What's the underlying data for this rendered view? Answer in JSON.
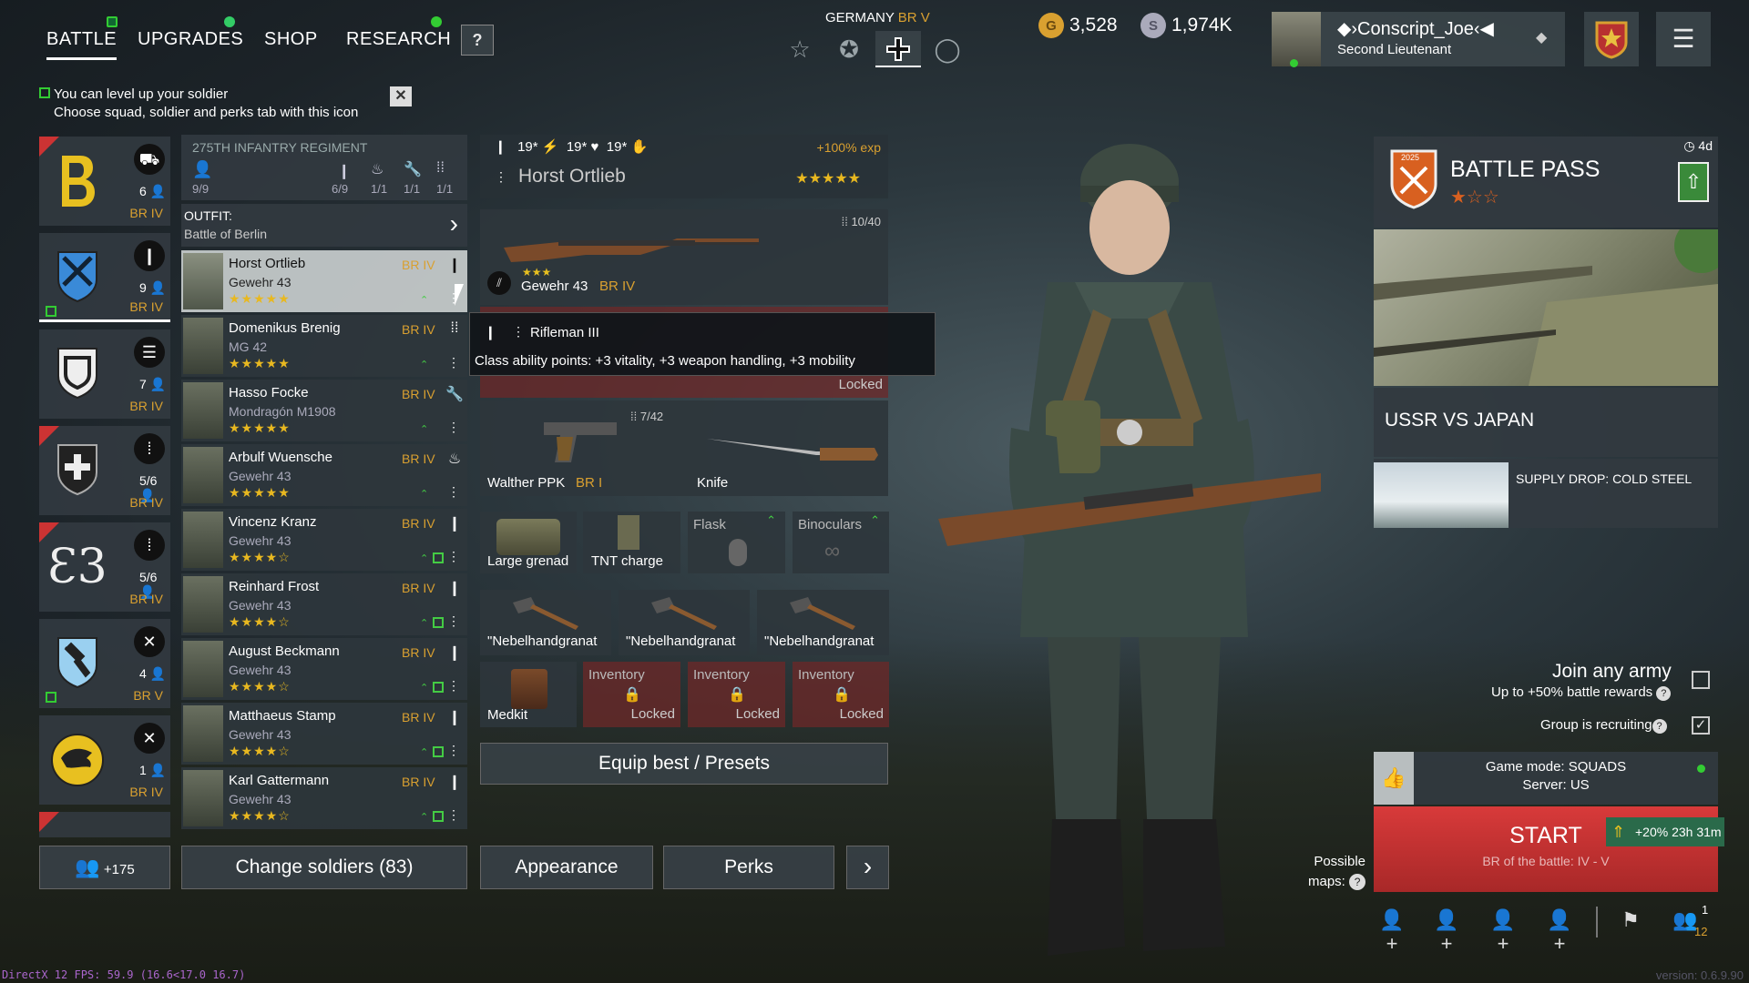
{
  "nav": {
    "tabs": [
      "BATTLE",
      "UPGRADES",
      "SHOP",
      "RESEARCH"
    ],
    "help": "?"
  },
  "army": {
    "nation": "GERMANY",
    "br": "BR V"
  },
  "currency": {
    "gold": "3,528",
    "silver": "1,974K"
  },
  "profile": {
    "name": "Conscript_Joe",
    "rank": "Second Lieutenant"
  },
  "hint": {
    "line1": "You can level up your soldier",
    "line2": "Choose squad, soldier and perks tab with this icon"
  },
  "squads": [
    {
      "count": "6",
      "br": "BR IV"
    },
    {
      "count": "9",
      "br": "BR IV"
    },
    {
      "count": "7",
      "br": "BR IV"
    },
    {
      "count": "5/6",
      "br": "BR IV"
    },
    {
      "count": "5/6",
      "br": "BR IV"
    },
    {
      "count": "4",
      "br": "BR V"
    },
    {
      "count": "1",
      "br": "BR IV"
    }
  ],
  "regiment": {
    "name": "275TH INFANTRY REGIMENT",
    "members": "9/9",
    "slots": [
      "6/9",
      "1/1",
      "1/1",
      "1/1"
    ]
  },
  "outfit": {
    "label": "OUTFIT:",
    "value": "Battle of Berlin"
  },
  "soldiers": [
    {
      "name": "Horst Ortlieb",
      "weapon": "Gewehr 43",
      "br": "BR IV",
      "stars": "★★★★★"
    },
    {
      "name": "Domenikus Brenig",
      "weapon": "MG 42",
      "br": "BR IV",
      "stars": "★★★★★"
    },
    {
      "name": "Hasso Focke",
      "weapon": "Mondragón M1908",
      "br": "BR IV",
      "stars": "★★★★★"
    },
    {
      "name": "Arbulf Wuensche",
      "weapon": "Gewehr 43",
      "br": "BR IV",
      "stars": "★★★★★"
    },
    {
      "name": "Vincenz Kranz",
      "weapon": "Gewehr 43",
      "br": "BR IV",
      "stars": "★★★★☆"
    },
    {
      "name": "Reinhard Frost",
      "weapon": "Gewehr 43",
      "br": "BR IV",
      "stars": "★★★★☆"
    },
    {
      "name": "August Beckmann",
      "weapon": "Gewehr 43",
      "br": "BR IV",
      "stars": "★★★★☆"
    },
    {
      "name": "Matthaeus Stamp",
      "weapon": "Gewehr 43",
      "br": "BR IV",
      "stars": "★★★★☆"
    },
    {
      "name": "Karl Gattermann",
      "weapon": "Gewehr 43",
      "br": "BR IV",
      "stars": "★★★★☆"
    }
  ],
  "selected": {
    "stats": [
      "19*",
      "19*",
      "19*"
    ],
    "exp": "+100% exp",
    "name": "Horst Ortlieb",
    "stars": "★★★★★"
  },
  "equipment": {
    "primary": {
      "name": "Gewehr 43",
      "br": "BR IV",
      "ammo": "10/40",
      "stars": "★★★"
    },
    "secondary_locked": "Locked",
    "pistol": {
      "name": "Walther PPK",
      "br": "BR I",
      "ammo": "7/42"
    },
    "melee": {
      "name": "Knife"
    },
    "slots": [
      "Large grenad",
      "TNT charge",
      "Flask",
      "Binoculars"
    ],
    "grenades": [
      "\"Nebelhandgranat",
      "\"Nebelhandgranat",
      "\"Nebelhandgranat"
    ],
    "medkit": "Medkit",
    "inventory": [
      {
        "label": "Inventory",
        "status": "Locked"
      },
      {
        "label": "Inventory",
        "status": "Locked"
      },
      {
        "label": "Inventory",
        "status": "Locked"
      }
    ]
  },
  "tooltip": {
    "title": "Rifleman III",
    "text": "Class ability points: +3 vitality, +3 weapon handling, +3 mobility"
  },
  "buttons": {
    "equip": "Equip best / Presets",
    "squad_extra": "+175",
    "change": "Change soldiers (83)",
    "appearance": "Appearance",
    "perks": "Perks",
    "next": "›"
  },
  "battlepass": {
    "title": "BATTLE PASS",
    "timer": "4d",
    "year": "2025",
    "stars": "★☆☆"
  },
  "event": {
    "title": "USSR VS JAPAN"
  },
  "supply": {
    "title": "SUPPLY DROP: COLD STEEL"
  },
  "join": {
    "title": "Join any army",
    "sub": "Up to +50% battle rewards"
  },
  "recruit": {
    "label": "Group is recruiting"
  },
  "mode": {
    "mode": "Game mode: SQUADS",
    "server": "Server: US"
  },
  "start": {
    "label": "START",
    "br": "BR of the battle: IV - V",
    "bonus": "+20% 23h 31m"
  },
  "maps": {
    "label1": "Possible",
    "label2": "maps:"
  },
  "party": {
    "count1": "1",
    "count2": "12"
  },
  "footer": {
    "fps": "DirectX 12 FPS: 59.9 (16.6<17.0 16.7)",
    "version": "version: 0.6.9.90"
  },
  "colors": {
    "accent_gold": "#d9a030",
    "start_red": "#d83a3a",
    "green": "#44cc44"
  }
}
